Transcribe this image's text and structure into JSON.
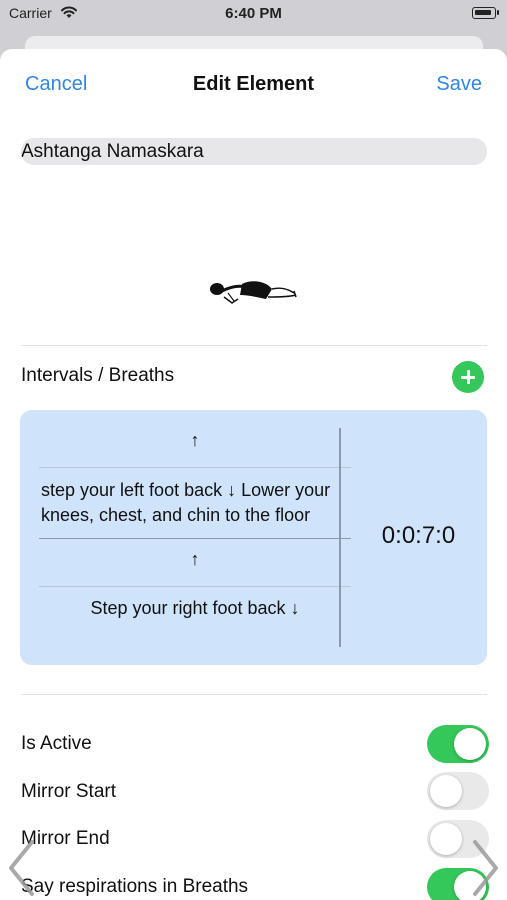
{
  "status_bar": {
    "carrier": "Carrier",
    "time": "6:40 PM"
  },
  "nav": {
    "cancel": "Cancel",
    "title": "Edit Element",
    "save": "Save"
  },
  "name_field": {
    "value": "Ashtanga Namaskara"
  },
  "intervals": {
    "label": "Intervals / Breaths",
    "items": [
      {
        "text": "↑"
      },
      {
        "text": "step your left foot back ↓ Lower your knees, chest, and chin to the floor"
      },
      {
        "text": "↑"
      },
      {
        "text": "Step your right foot back ↓"
      }
    ],
    "duration": "0:0:7:0"
  },
  "toggles": [
    {
      "label": "Is Active",
      "on": true
    },
    {
      "label": "Mirror Start",
      "on": false
    },
    {
      "label": "Mirror End",
      "on": false
    },
    {
      "label": "Say respirations in Breaths",
      "on": true
    }
  ],
  "colors": {
    "accent": "#2f86e8",
    "green": "#34c759",
    "card": "#cfe3fb"
  }
}
